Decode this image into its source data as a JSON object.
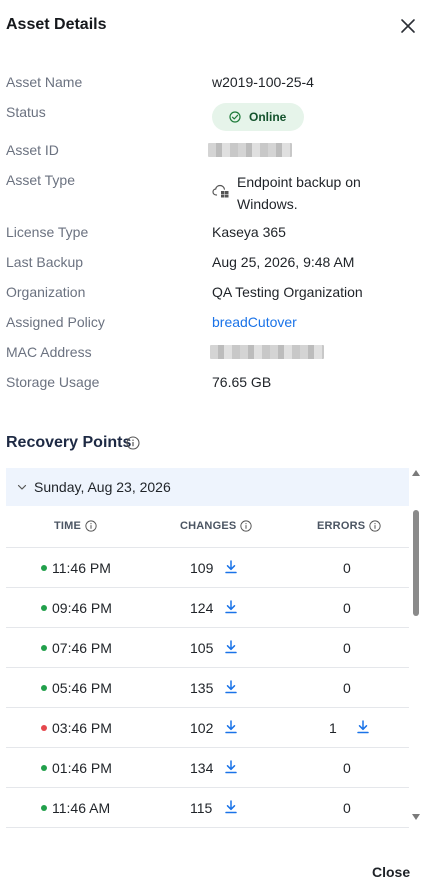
{
  "header": {
    "title": "Asset Details"
  },
  "details": {
    "asset_name": {
      "label": "Asset Name",
      "value": "w2019-100-25-4"
    },
    "status": {
      "label": "Status",
      "value": "Online"
    },
    "asset_id": {
      "label": "Asset ID"
    },
    "asset_type": {
      "label": "Asset Type",
      "value": "Endpoint backup on Windows."
    },
    "license_type": {
      "label": "License Type",
      "value": "Kaseya 365"
    },
    "last_backup": {
      "label": "Last Backup",
      "value": "Aug 25, 2026, 9:48 AM"
    },
    "organization": {
      "label": "Organization",
      "value": "QA Testing Organization"
    },
    "assigned_policy": {
      "label": "Assigned Policy",
      "value": "breadCutover"
    },
    "mac_address": {
      "label": "MAC Address"
    },
    "storage_usage": {
      "label": "Storage Usage",
      "value": "76.65 GB"
    }
  },
  "recovery_points": {
    "title": "Recovery Points",
    "group_label": "Sunday, Aug 23, 2026",
    "columns": {
      "time": "TIME",
      "changes": "CHANGES",
      "errors": "ERRORS"
    },
    "rows": [
      {
        "time": "11:46 PM",
        "changes": "109",
        "errors": "0",
        "status": "ok"
      },
      {
        "time": "09:46 PM",
        "changes": "124",
        "errors": "0",
        "status": "ok"
      },
      {
        "time": "07:46 PM",
        "changes": "105",
        "errors": "0",
        "status": "ok"
      },
      {
        "time": "05:46 PM",
        "changes": "135",
        "errors": "0",
        "status": "ok"
      },
      {
        "time": "03:46 PM",
        "changes": "102",
        "errors": "1",
        "status": "error"
      },
      {
        "time": "01:46 PM",
        "changes": "134",
        "errors": "0",
        "status": "ok"
      },
      {
        "time": "11:46 AM",
        "changes": "115",
        "errors": "0",
        "status": "ok"
      }
    ]
  },
  "footer": {
    "close_label": "Close"
  },
  "colors": {
    "ok": "#22a04b",
    "error": "#e5484d",
    "accent": "#1a73e8"
  },
  "icons": {
    "close": "close-icon",
    "status": "check-circle-icon",
    "asset_type": "cloud-windows-icon",
    "info": "info-icon",
    "chevron": "chevron-down-icon",
    "download": "download-icon"
  }
}
